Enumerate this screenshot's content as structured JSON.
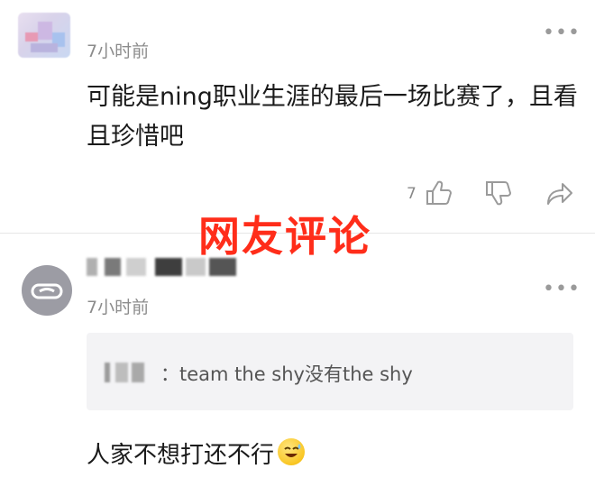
{
  "comment1": {
    "time": "7小时前",
    "text": "可能是ning职业生涯的最后一场比赛了，且看且珍惜吧",
    "like_count": "7"
  },
  "overlay": {
    "label": "网友评论",
    "color": "#ff2d1a"
  },
  "comment2": {
    "time": "7小时前",
    "quote_text": "：team the shy没有the shy",
    "reply": "人家不想打还不行"
  },
  "icons": {
    "more": "more-dots-icon",
    "like": "thumbs-up-icon",
    "dislike": "thumbs-down-icon",
    "share": "share-arrow-icon",
    "emoji": "sweat-smile-emoji"
  },
  "colors": {
    "muted": "#8c8c8c",
    "quote_bg": "#f3f3f5"
  }
}
